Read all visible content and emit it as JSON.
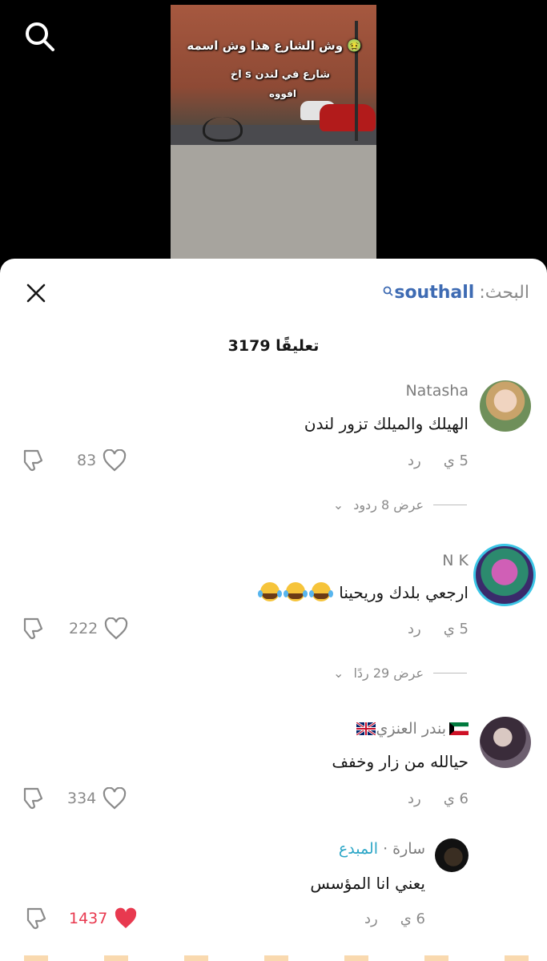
{
  "video": {
    "caption_line1": "وش الشارع هذا وش اسمه 🤢",
    "caption_line2": "اخ s شارع في لندن",
    "caption_line3": "افووه"
  },
  "sheet": {
    "search_prefix": "البحث:",
    "search_term": "southall",
    "comment_count": "3179 تعليقًا"
  },
  "comments": [
    {
      "author": "Natasha",
      "text": "الهيلك والميلك تزور لندن",
      "time": "5 ي",
      "reply": "رد",
      "likes": "83",
      "replies": "عرض 8 ردود"
    },
    {
      "author": "N K",
      "text": "ارجعي بلدك وريحينا",
      "time": "5 ي",
      "reply": "رد",
      "likes": "222",
      "replies": "عرض 29 ردًا"
    },
    {
      "author": "بندر العنزي",
      "text": "حيالله من زار وخفف",
      "time": "6 ي",
      "reply": "رد",
      "likes": "334"
    },
    {
      "author": "سارة",
      "author_separator": "·",
      "author_badge": "المبدع",
      "text": "يعني انا المؤسس",
      "time": "6 ي",
      "reply": "رد",
      "likes": "1437"
    }
  ],
  "colors": {
    "accent_blue": "#3e6bb3",
    "like_red": "#e8394f",
    "creator_badge": "#2aa5c6"
  }
}
